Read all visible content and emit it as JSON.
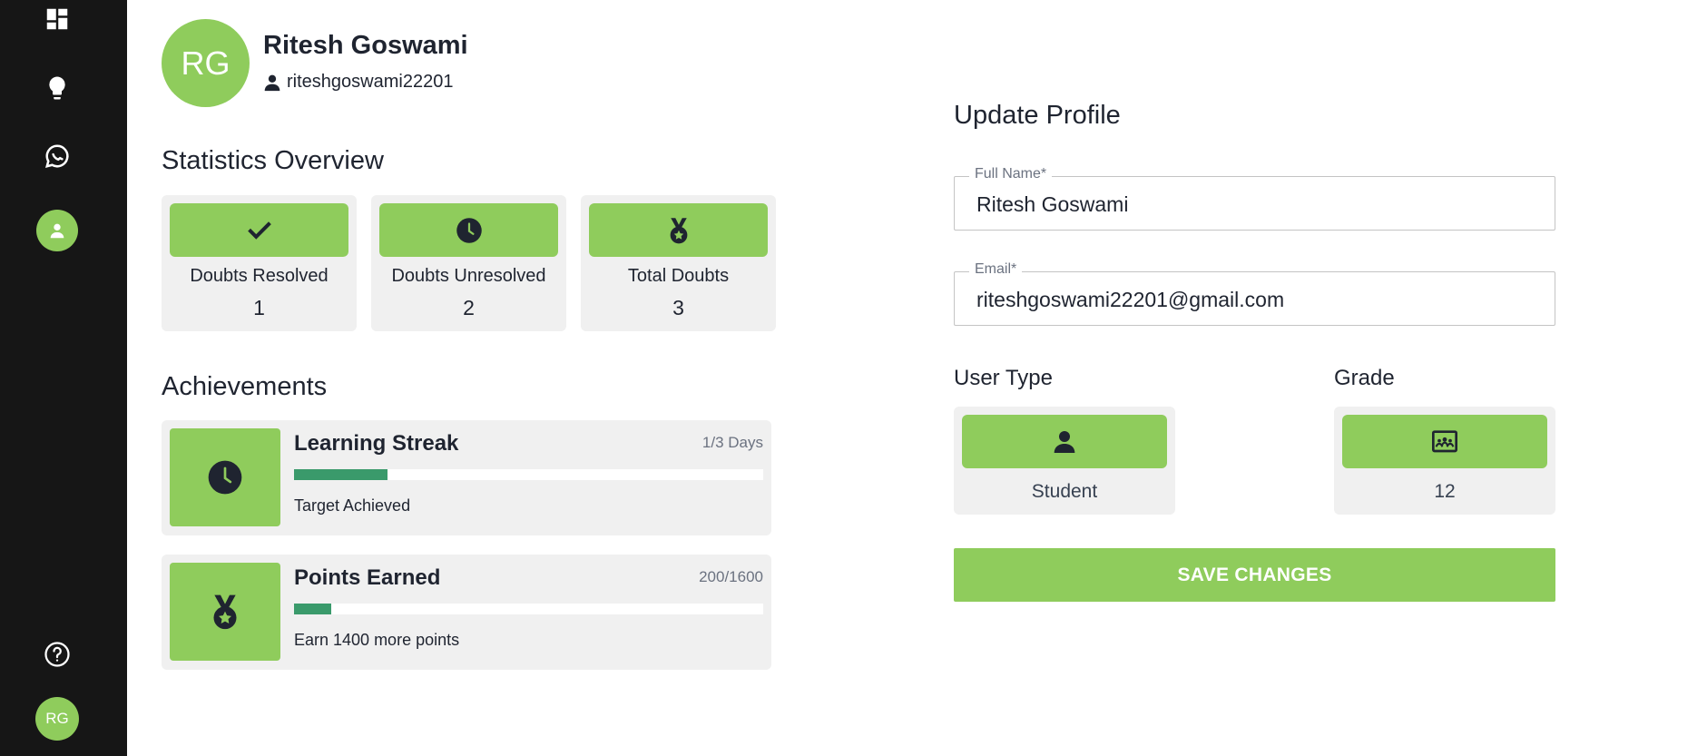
{
  "sidebar": {
    "items": [
      {
        "icon": "dashboard-icon"
      },
      {
        "icon": "lightbulb-icon"
      },
      {
        "icon": "chat-icon"
      },
      {
        "icon": "profile-icon",
        "active": true
      }
    ],
    "help_icon": "help-icon",
    "avatar_initials": "RG"
  },
  "profile": {
    "initials": "RG",
    "name": "Ritesh Goswami",
    "username": "riteshgoswami22201"
  },
  "statistics": {
    "title": "Statistics Overview",
    "cards": [
      {
        "icon": "check-icon",
        "label": "Doubts Resolved",
        "value": "1"
      },
      {
        "icon": "clock-icon",
        "label": "Doubts Unresolved",
        "value": "2"
      },
      {
        "icon": "medal-icon",
        "label": "Total Doubts",
        "value": "3"
      }
    ]
  },
  "achievements": {
    "title": "Achievements",
    "items": [
      {
        "icon": "clock-icon",
        "title": "Learning Streak",
        "meta": "1/3 Days",
        "progress": 0.2,
        "note": "Target Achieved"
      },
      {
        "icon": "medal-icon",
        "title": "Points Earned",
        "meta": "200/1600",
        "progress": 0.08,
        "note": "Earn 1400 more points"
      }
    ]
  },
  "update_profile": {
    "title": "Update Profile",
    "full_name": {
      "label": "Full Name*",
      "value": "Ritesh Goswami"
    },
    "email": {
      "label": "Email*",
      "value": "riteshgoswami22201@gmail.com"
    },
    "user_type": {
      "label": "User Type",
      "value": "Student",
      "icon": "person-icon"
    },
    "grade": {
      "label": "Grade",
      "value": "12",
      "icon": "classroom-icon"
    },
    "save_label": "SAVE CHANGES"
  },
  "colors": {
    "sidebar_bg": "#161616",
    "accent": "#8fcc5c",
    "progress": "#3a9a6b",
    "card_bg": "#f0f0f0"
  }
}
